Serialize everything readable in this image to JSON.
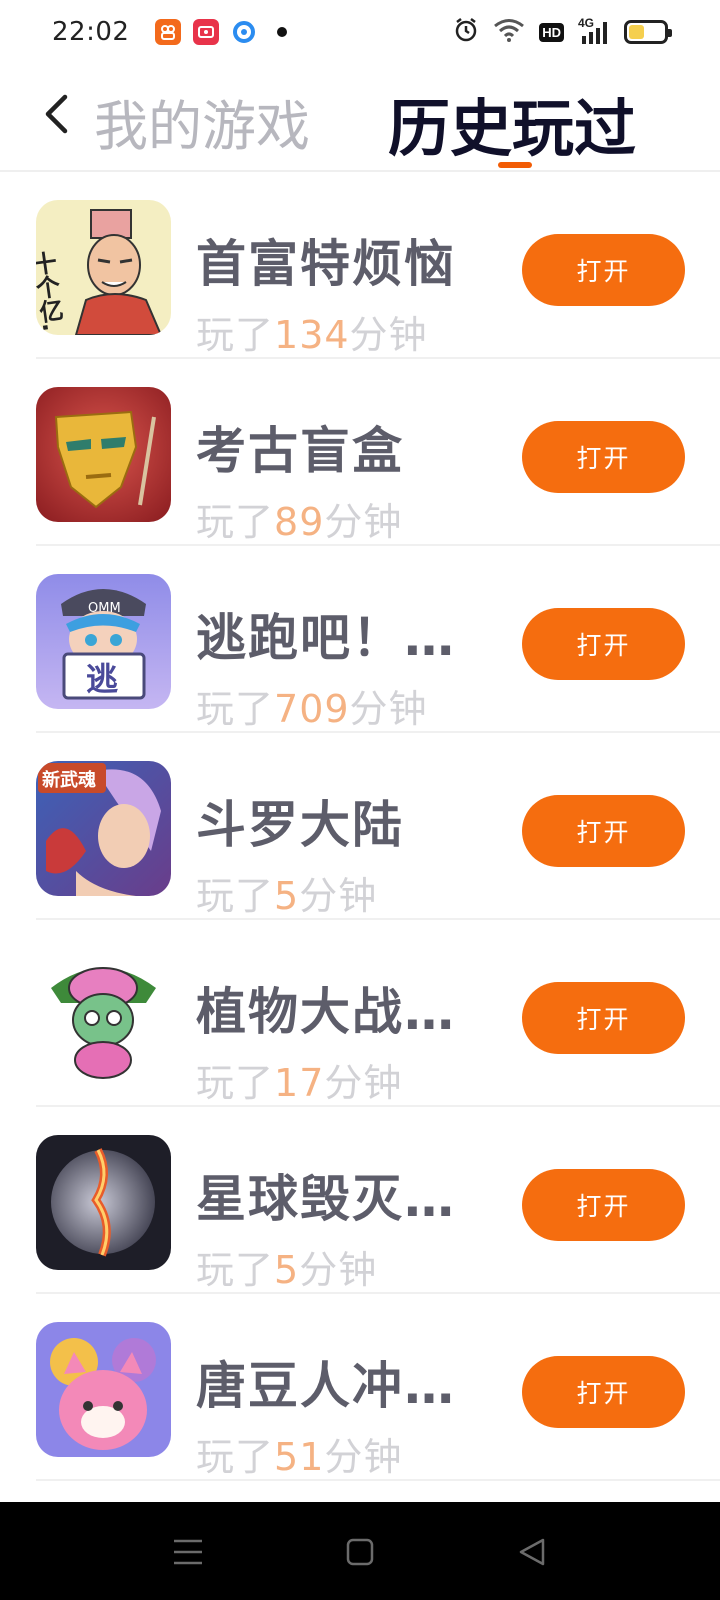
{
  "status_bar": {
    "time": "22:02",
    "hd_label": "HD",
    "network_label": "4G",
    "battery_level": 0.45,
    "colors": {
      "app1": "#f36a1c",
      "app2": "#e8334a",
      "app3": "#2b8cf0",
      "battery": "#f5cf4e"
    }
  },
  "header": {
    "back_icon": "chevron-left-icon",
    "tab_my_games": "我的游戏",
    "tab_history": "历史玩过"
  },
  "games": [
    {
      "name": "首富特烦恼",
      "played_prefix": "玩了",
      "minutes": "134",
      "played_suffix": "分钟",
      "button": "打开"
    },
    {
      "name": "考古盲盒",
      "played_prefix": "玩了",
      "minutes": "89",
      "played_suffix": "分钟",
      "button": "打开"
    },
    {
      "name": "逃跑吧！少年",
      "played_prefix": "玩了",
      "minutes": "709",
      "played_suffix": "分钟",
      "button": "打开"
    },
    {
      "name": "斗罗大陆",
      "played_prefix": "玩了",
      "minutes": "5",
      "played_suffix": "分钟",
      "button": "打开"
    },
    {
      "name": "植物大战僵尸",
      "played_prefix": "玩了",
      "minutes": "17",
      "played_suffix": "分钟",
      "button": "打开"
    },
    {
      "name": "星球毁灭模拟器",
      "played_prefix": "玩了",
      "minutes": "5",
      "played_suffix": "分钟",
      "button": "打开"
    },
    {
      "name": "唐豆人冲冲冲",
      "played_prefix": "玩了",
      "minutes": "51",
      "played_suffix": "分钟",
      "button": "打开"
    }
  ],
  "thumb_labels": {
    "game1": "十个亿…",
    "game3_cap": "OMM",
    "game3_sign": "逃",
    "game4_badge": "新武魂"
  },
  "accent_color": "#f56d0f",
  "nav": {
    "menu_icon": "menu-icon",
    "home_icon": "home-square-icon",
    "back_icon": "back-triangle-icon"
  }
}
